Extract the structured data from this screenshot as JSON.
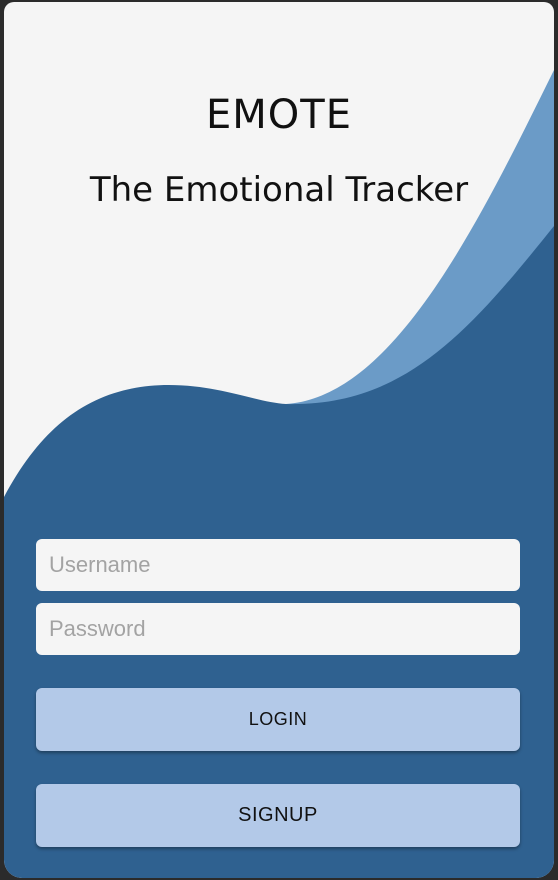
{
  "app": {
    "title": "EMOTE",
    "subtitle": "The Emotional Tracker"
  },
  "form": {
    "username_placeholder": "Username",
    "username_value": "",
    "password_placeholder": "Password",
    "password_value": "",
    "login_label": "LOGIN",
    "signup_label": "SIGNUP"
  },
  "colors": {
    "background": "#f5f5f5",
    "wave_dark": "#2f6190",
    "wave_light": "#6b9bc7",
    "field_background": "#f5f5f5",
    "button_background": "#b3c9e8",
    "text": "#111111",
    "placeholder": "#a3a3a3"
  }
}
